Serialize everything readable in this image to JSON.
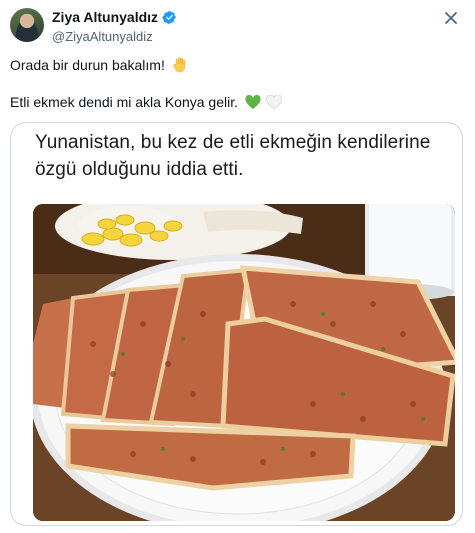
{
  "author": {
    "display_name": "Ziya Altunyaldız",
    "handle": "@ZiyaAltunyaldiz",
    "verified": true,
    "avatar_icon": "profile-photo",
    "verified_color": "#1d9bf0"
  },
  "actions": {
    "close_icon": "close-icon"
  },
  "tweet": {
    "line1": "Orada bir durun bakalım!",
    "line2": "Etli ekmek dendi mi akla Konya gelir.",
    "emoji1": "raised-hand",
    "emoji2": [
      "green-heart",
      "white-heart"
    ]
  },
  "card": {
    "headline_line1": "Yunanistan, bu kez de etli ekmeğin kendilerine",
    "headline_line2": "özgü olduğunu iddia etti.",
    "image": "photo-of-etli-ekmek-on-plate"
  },
  "colors": {
    "text": "#0f1419",
    "secondary": "#536471",
    "border": "#cfd9de",
    "heart_green": "#5fb346"
  }
}
